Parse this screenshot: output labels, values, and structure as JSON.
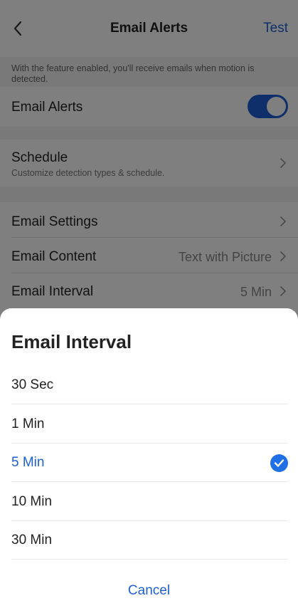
{
  "header": {
    "title": "Email Alerts",
    "test_label": "Test"
  },
  "page": {
    "description": "With the feature enabled, you'll receive emails when motion is detected.",
    "email_alerts": {
      "label": "Email Alerts",
      "enabled": true
    },
    "schedule": {
      "label": "Schedule",
      "subtitle": "Customize detection types & schedule."
    },
    "email_settings": {
      "label": "Email Settings"
    },
    "email_content": {
      "label": "Email Content",
      "value": "Text with Picture"
    },
    "email_interval": {
      "label": "Email Interval",
      "value": "5 Min"
    }
  },
  "sheet": {
    "title": "Email Interval",
    "options": [
      {
        "label": "30 Sec",
        "selected": false
      },
      {
        "label": "1 Min",
        "selected": false
      },
      {
        "label": "5 Min",
        "selected": true
      },
      {
        "label": "10 Min",
        "selected": false
      },
      {
        "label": "30 Min",
        "selected": false
      }
    ],
    "cancel_label": "Cancel"
  },
  "colors": {
    "accent": "#1f5fd6",
    "check": "#1f6fe6"
  }
}
